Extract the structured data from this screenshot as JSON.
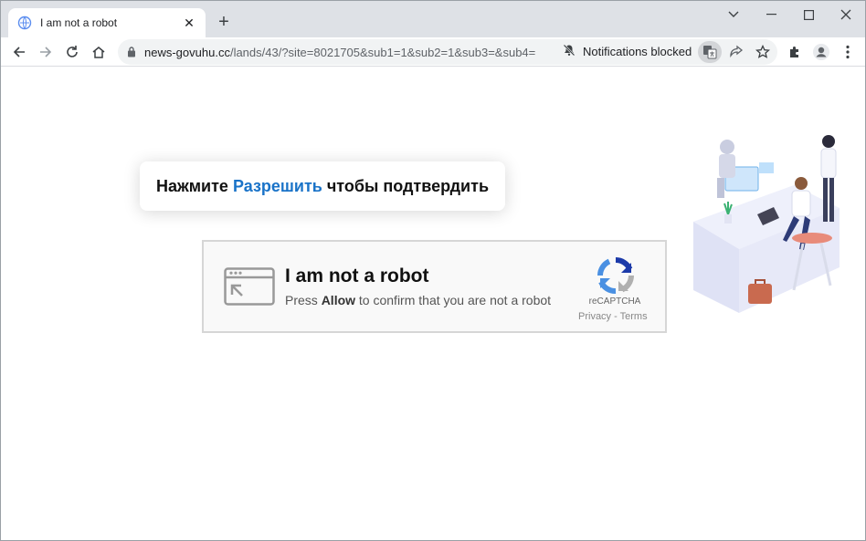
{
  "browser": {
    "tab": {
      "title": "I am not a robot",
      "close_glyph": "✕"
    },
    "new_tab_glyph": "+",
    "window_controls": {
      "dropdown": "⌄",
      "minimize": "—",
      "maximize": "☐",
      "close": "✕"
    },
    "address": {
      "domain": "news-govuhu.cc",
      "path": "/lands/43/?site=8021705&sub1=1&sub2=1&sub3=&sub4="
    },
    "notifications_status": "Notifications blocked",
    "icons": [
      "back-icon",
      "forward-icon",
      "reload-icon",
      "home-icon",
      "lock-icon",
      "bell-off-icon",
      "translate-icon",
      "share-icon",
      "star-icon",
      "extensions-icon",
      "profile-icon",
      "menu-icon"
    ]
  },
  "page": {
    "prompt": {
      "before": "Нажмите ",
      "highlight": "Разрешить",
      "after": " чтобы подтвердить"
    },
    "captcha": {
      "title": "I am not a robot",
      "subtitle_prefix": "Press ",
      "subtitle_bold": "Allow",
      "subtitle_suffix": " to confirm that you are not a robot",
      "brand": "reCAPTCHA",
      "links": "Privacy - Terms"
    }
  },
  "colors": {
    "highlight": "#1a73c8",
    "recaptcha_blue": "#1c3aa9",
    "recaptcha_light": "#4a90e2",
    "recaptcha_gray": "#b0b0b0"
  }
}
